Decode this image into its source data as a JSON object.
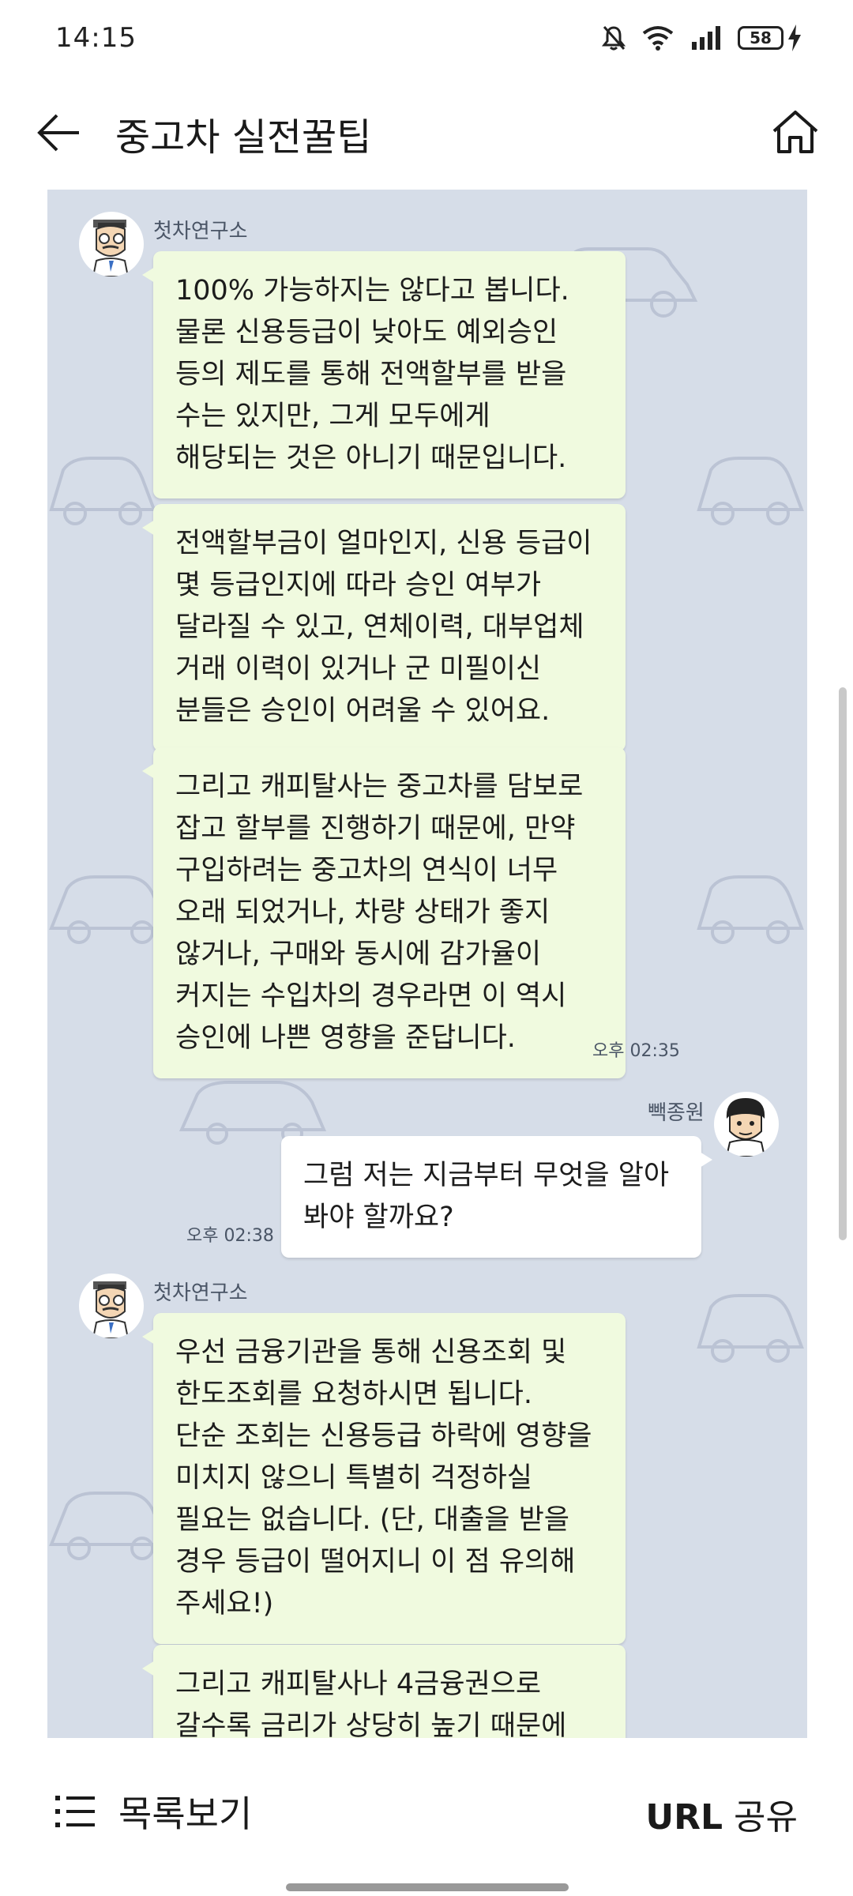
{
  "status_bar": {
    "time": "14:15",
    "battery": "58"
  },
  "header": {
    "title": "중고차 실전꿀팁"
  },
  "messages": [
    {
      "sender": "첫차연구소",
      "text": "100% 가능하지는 않다고 봅니다.\n물론 신용등급이 낮아도 예외승인\n등의 제도를 통해 전액할부를 받을\n수는 있지만, 그게 모두에게\n해당되는 것은 아니기 때문입니다."
    },
    {
      "text": "전액할부금이 얼마인지, 신용 등급이\n몇 등급인지에 따라 승인 여부가\n달라질 수 있고, 연체이력, 대부업체\n거래 이력이 있거나 군 미필이신\n분들은 승인이 어려울 수 있어요."
    },
    {
      "text": "그리고 캐피탈사는 중고차를 담보로\n잡고 할부를 진행하기 때문에, 만약\n구입하려는 중고차의 연식이 너무\n오래 되었거나, 차량 상태가 좋지\n않거나, 구매와 동시에 감가율이\n커지는 수입차의 경우라면 이 역시\n승인에 나쁜 영향을 준답니다.",
      "time": "오후 02:35"
    },
    {
      "sender": "빽종원",
      "text": "그럼 저는 지금부터 무엇을 알아\n봐야 할까요?",
      "time": "오후 02:38"
    },
    {
      "sender": "첫차연구소",
      "text": "우선 금융기관을 통해 신용조회 및\n한도조회를 요청하시면 됩니다.\n단순 조회는 신용등급 하락에 영향을\n미치지 않으니 특별히 걱정하실\n필요는 없습니다. (단, 대출을 받을\n경우 등급이 떨어지니 이 점 유의해\n주세요!)"
    },
    {
      "text": "그리고 캐피탈사나 4금융권으로\n갈수록 금리가 상당히 높기 때문에"
    }
  ],
  "bottom_bar": {
    "list_label": "목록보기",
    "share_label_bold": "URL",
    "share_label": "공유"
  },
  "colors": {
    "chat_bg": "#d6dde8",
    "bubble_in": "#f0fadf",
    "bubble_out": "#ffffff"
  }
}
